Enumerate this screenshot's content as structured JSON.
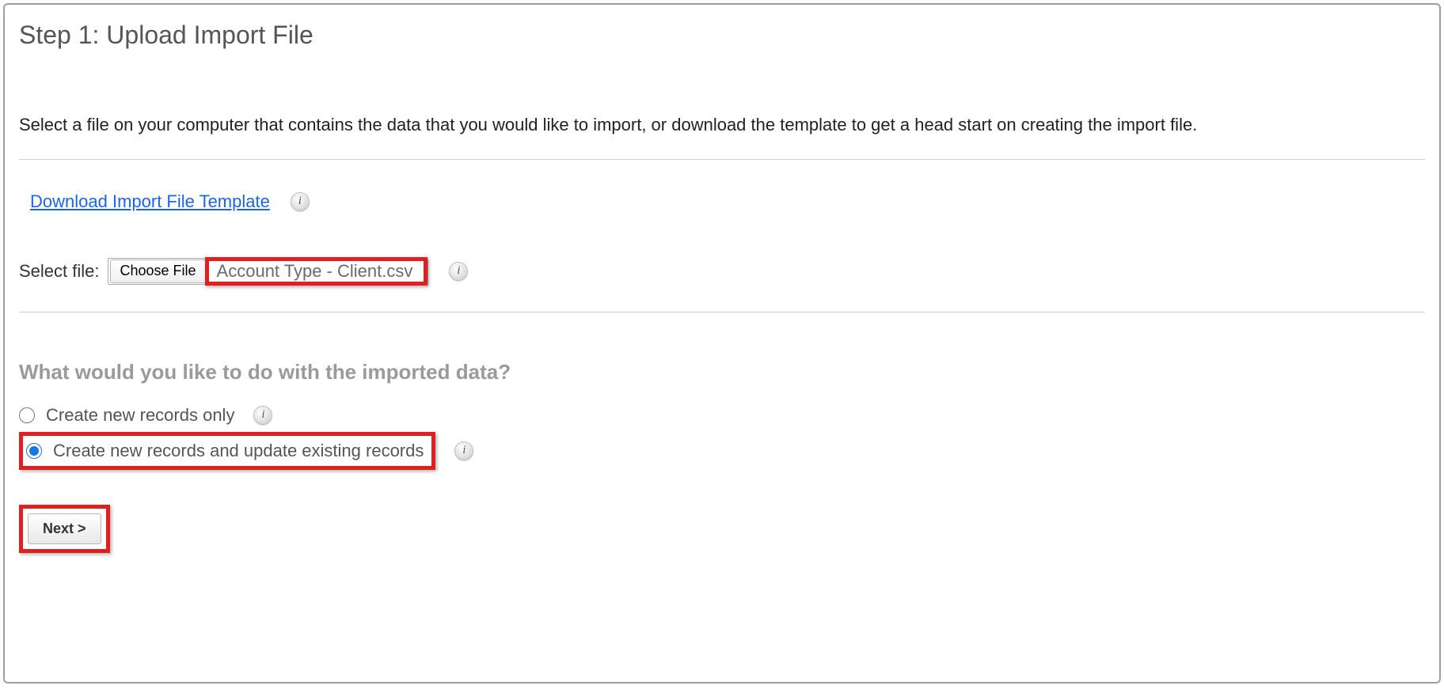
{
  "step_title": "Step 1: Upload Import File",
  "intro_text": "Select a file on your computer that contains the data that you would like to import, or download the template to get a head start on creating the import file.",
  "template_link_label": "Download Import File Template",
  "file": {
    "label": "Select file:",
    "choose_button_label": "Choose File",
    "chosen_filename": "Account Type - Client.csv"
  },
  "import_question": "What would you like to do with the imported data?",
  "radio_options": {
    "create_only": {
      "label": "Create new records only",
      "checked": false
    },
    "create_update": {
      "label": "Create new records and update existing records",
      "checked": true
    }
  },
  "next_button_label": "Next >",
  "info_glyph": "i"
}
